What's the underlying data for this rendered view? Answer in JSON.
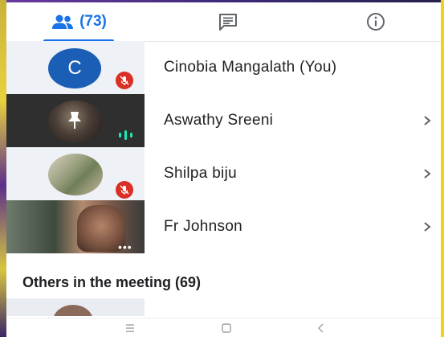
{
  "tabs": {
    "people_count": "(73)",
    "chat_icon": "chat-icon",
    "info_icon": "info-icon"
  },
  "participants": [
    {
      "name": "Cinobia Mangalath (You)",
      "avatar_letter": "C",
      "status": "muted",
      "avatar_color": "#1b5eb6"
    },
    {
      "name": "Aswathy Sreeni",
      "status": "speaking",
      "pinned": true
    },
    {
      "name": "Shilpa biju",
      "status": "muted"
    },
    {
      "name": "Fr Johnson",
      "status": "video"
    }
  ],
  "others": {
    "heading": "Others in the meeting (69)"
  },
  "colors": {
    "accent": "#1a73e8",
    "mute_red": "#d93025",
    "speaking_teal": "#1de9b6",
    "avatar_blue": "#1b5eb6"
  }
}
